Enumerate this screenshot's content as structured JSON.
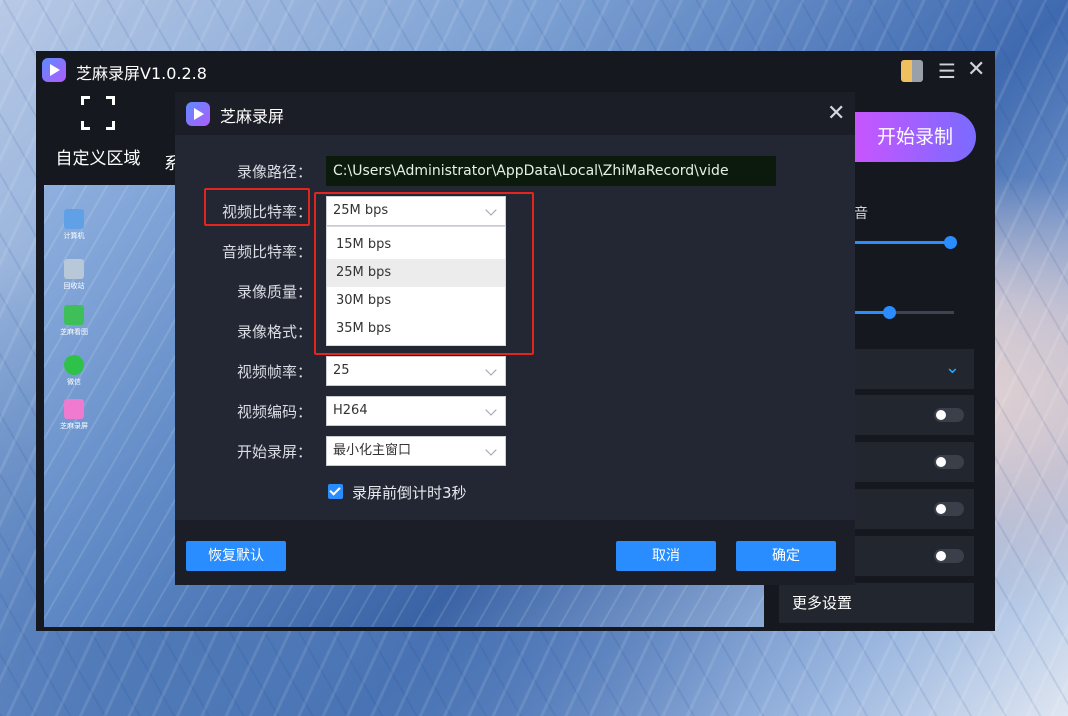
{
  "window": {
    "title": "芝麻录屏V1.0.2.8"
  },
  "main": {
    "custom_area_label": "自定义区域",
    "partial_tab_label": "系",
    "start_record_label": "开始录制",
    "more_settings_label": "更多设置",
    "right_panel_partial_text": "音"
  },
  "desktop_icons": [
    {
      "label": "计算机",
      "color": "#5fa0e6"
    },
    {
      "label": "回收站",
      "color": "#b9c8d8"
    },
    {
      "label": "芝麻看图",
      "color": "#3fbf5a"
    },
    {
      "label": "微信",
      "color": "#2ec24a"
    },
    {
      "label": "芝麻录屏",
      "color": "#f07ad0"
    }
  ],
  "dialog": {
    "title": "芝麻录屏",
    "labels": {
      "path": "录像路径：",
      "video_bitrate": "视频比特率：",
      "audio_bitrate": "音频比特率：",
      "quality": "录像质量：",
      "format": "录像格式：",
      "framerate": "视频帧率：",
      "encoder": "视频编码：",
      "start_record": "开始录屏："
    },
    "path_value": "C:\\Users\\Administrator\\AppData\\Local\\ZhiMaRecord\\vide",
    "video_bitrate_value": "25M bps",
    "bitrate_options": [
      "15M bps",
      "25M bps",
      "30M bps",
      "35M bps"
    ],
    "framerate_value": "25",
    "encoder_value": "H264",
    "start_record_value": "最小化主窗口",
    "countdown_label": "录屏前倒计时3秒",
    "reset_label": "恢复默认",
    "cancel_label": "取消",
    "confirm_label": "确定"
  },
  "colors": {
    "accent": "#2a8dff",
    "highlight_box": "#e0261f",
    "start_gradient_from": "#c855ff",
    "start_gradient_to": "#7a6bff"
  }
}
